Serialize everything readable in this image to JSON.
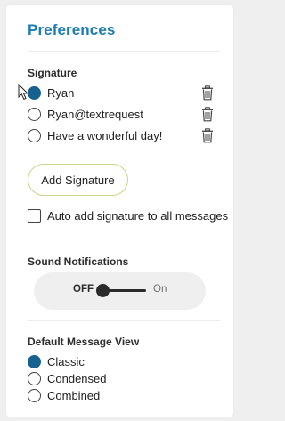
{
  "colors": {
    "accent": "#16618f",
    "title": "#1b7cb2",
    "button_border": "#c9d788"
  },
  "title": "Preferences",
  "signature": {
    "label": "Signature",
    "items": [
      {
        "label": "Ryan",
        "selected": true
      },
      {
        "label": "Ryan@textrequest",
        "selected": false
      },
      {
        "label": "Have a wonderful day!",
        "selected": false
      }
    ],
    "add_button": "Add Signature",
    "auto_add_label": "Auto add signature to all messages",
    "auto_add_checked": false
  },
  "sound": {
    "label": "Sound Notifications",
    "off_label": "OFF",
    "on_label": "On",
    "state": "off"
  },
  "view": {
    "label": "Default Message View",
    "items": [
      {
        "label": "Classic",
        "selected": true
      },
      {
        "label": "Condensed",
        "selected": false
      },
      {
        "label": "Combined",
        "selected": false
      }
    ]
  },
  "icons": {
    "delete": "trash-icon",
    "cursor": "mouse-pointer-icon"
  }
}
